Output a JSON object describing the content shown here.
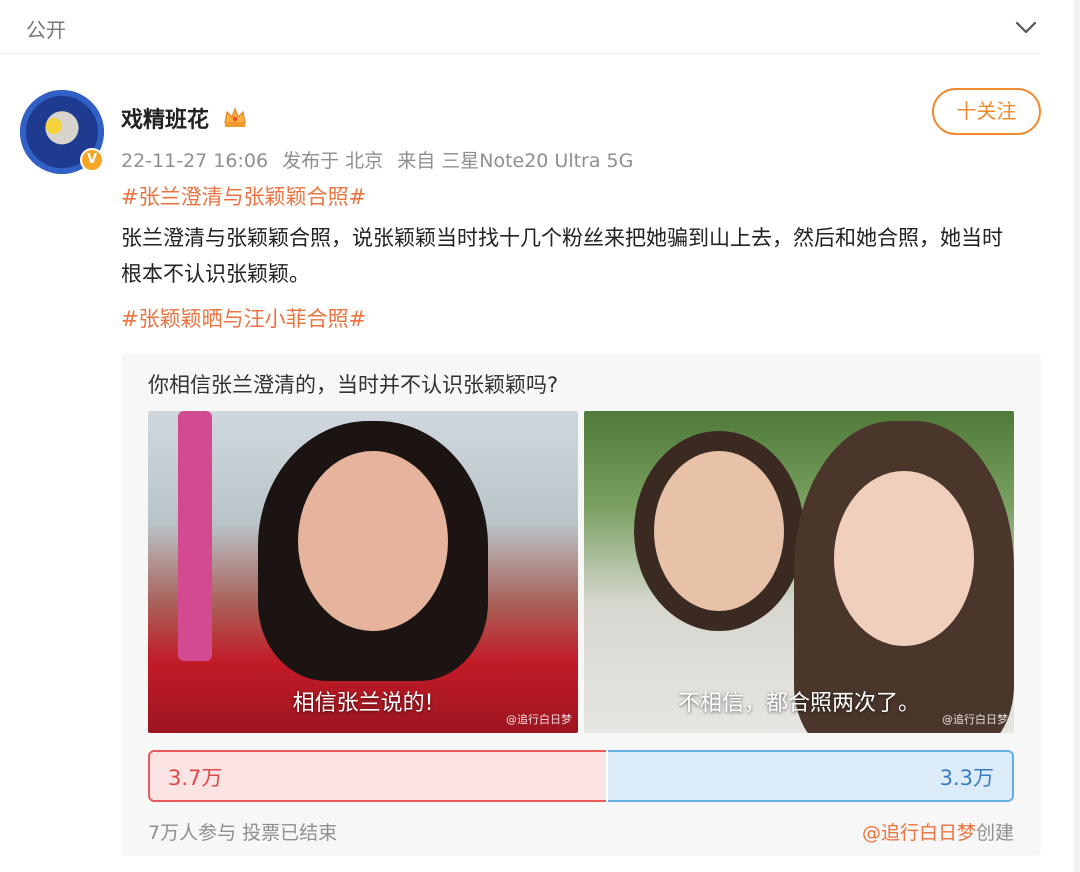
{
  "visibility": "公开",
  "user": {
    "name": "戏精班花",
    "verified_badge": "V"
  },
  "follow_label": "十关注",
  "meta": {
    "time": "22-11-27 16:06",
    "location": "发布于 北京",
    "source": "来自 三星Note20 Ultra 5G"
  },
  "post": {
    "topic1": "#张兰澄清与张颖颖合照#",
    "text": "张兰澄清与张颖颖合照，说张颖颖当时找十几个粉丝来把她骗到山上去，然后和她合照，她当时根本不认识张颖颖。",
    "topic2": "#张颖颖晒与汪小菲合照#"
  },
  "poll": {
    "question": "你相信张兰澄清的，当时并不认识张颖颖吗?",
    "options": [
      {
        "caption": "相信张兰说的!",
        "watermark": "@追行白日梦",
        "votes": "3.7万",
        "share": 0.53,
        "color": "#ea5a5a"
      },
      {
        "caption": "不相信，都合照两次了。",
        "watermark": "@追行白日梦",
        "votes": "3.3万",
        "share": 0.47,
        "color": "#64aee3"
      }
    ],
    "participants": "7万人参与",
    "status": "投票已结束",
    "creator": "@追行白日梦",
    "created_label": "创建"
  },
  "icons": {
    "collapse": "chevron-down-icon",
    "crown": "crown-icon",
    "verified": "verified-badge-icon"
  }
}
